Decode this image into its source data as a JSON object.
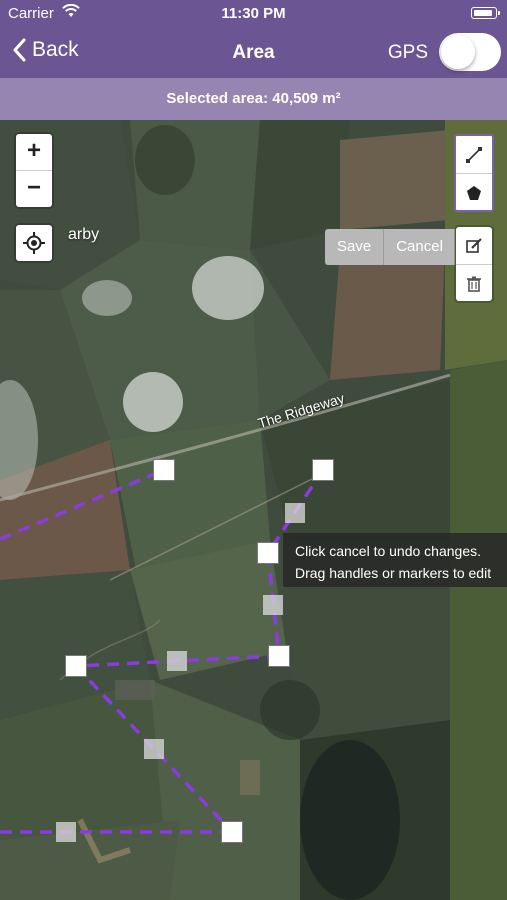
{
  "status_bar": {
    "carrier": "Carrier",
    "time": "11:30 PM",
    "wifi_icon": "wifi-icon",
    "battery_level": 0.9
  },
  "nav_bar": {
    "back_label": "Back",
    "title": "Area",
    "gps_label": "GPS",
    "gps_enabled": false
  },
  "info_bar": {
    "text": "Selected area: 40,509 m²"
  },
  "map": {
    "zoom_in": "+",
    "zoom_out": "−",
    "place_label": "arby",
    "road_label": "The Ridgeway",
    "actions": {
      "save": "Save",
      "cancel": "Cancel"
    },
    "tooltip": {
      "line1": "Click cancel to undo changes.",
      "line2": "Drag handles or markers to edit"
    },
    "colors": {
      "accent": "#6b5592",
      "polygon": "#8b3ce0"
    }
  }
}
